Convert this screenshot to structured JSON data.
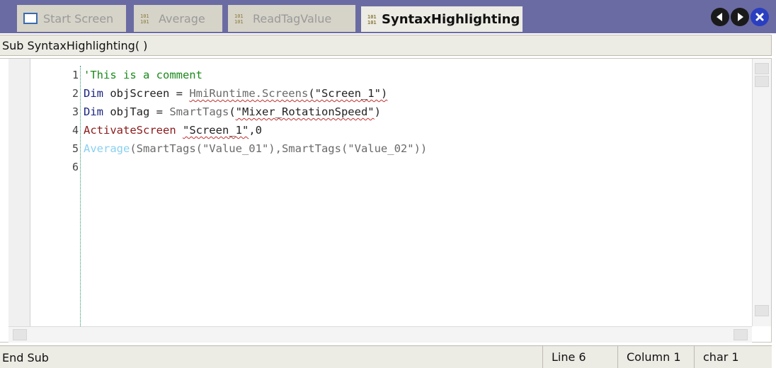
{
  "tabs": [
    {
      "label": "Start Screen",
      "icon": "screen-icon",
      "active": false
    },
    {
      "label": "Average",
      "icon": "script-icon",
      "active": false
    },
    {
      "label": "ReadTagValue",
      "icon": "script-icon",
      "active": false
    },
    {
      "label": "SyntaxHighlighting",
      "icon": "script-icon",
      "active": true
    }
  ],
  "nav": {
    "prev_icon": "arrow-left-icon",
    "next_icon": "arrow-right-icon",
    "close_icon": "close-icon"
  },
  "editor": {
    "header": "Sub SyntaxHighlighting( )",
    "footer": "End Sub",
    "line_numbers": [
      "1",
      "2",
      "3",
      "4",
      "5",
      "6"
    ],
    "lines": [
      [
        {
          "text": "'This is a comment",
          "type": "comment"
        }
      ],
      [
        {
          "text": "Dim",
          "type": "kw"
        },
        {
          "text": " objScreen = ",
          "type": "plain"
        },
        {
          "text": "HmiRuntime.Screens",
          "type": "obj",
          "squiggle": true
        },
        {
          "text": "(\"Screen_1\")",
          "type": "plain",
          "squiggle": true
        }
      ],
      [
        {
          "text": "Dim",
          "type": "kw"
        },
        {
          "text": " objTag = ",
          "type": "plain"
        },
        {
          "text": "SmartTags",
          "type": "obj"
        },
        {
          "text": "(",
          "type": "plain"
        },
        {
          "text": "\"Mixer_RotationSpeed\"",
          "type": "plain",
          "squiggle": true
        },
        {
          "text": ")",
          "type": "plain"
        }
      ],
      [
        {
          "text": "ActivateScreen ",
          "type": "fn"
        },
        {
          "text": "\"Screen_1\"",
          "type": "plain",
          "squiggle": true
        },
        {
          "text": ",0",
          "type": "plain"
        }
      ],
      [
        {
          "text": "Average",
          "type": "fnlight"
        },
        {
          "text": "(SmartTags(\"Value_01\"),SmartTags(\"Value_02\"))",
          "type": "obj"
        }
      ],
      []
    ]
  },
  "status": {
    "line": "Line 6",
    "column": "Column 1",
    "char": "char 1"
  },
  "colors": {
    "tabbar": "#6b6ba3",
    "comment": "#1a8a1a",
    "keyword": "#1a237e",
    "squiggle": "#c03030"
  }
}
